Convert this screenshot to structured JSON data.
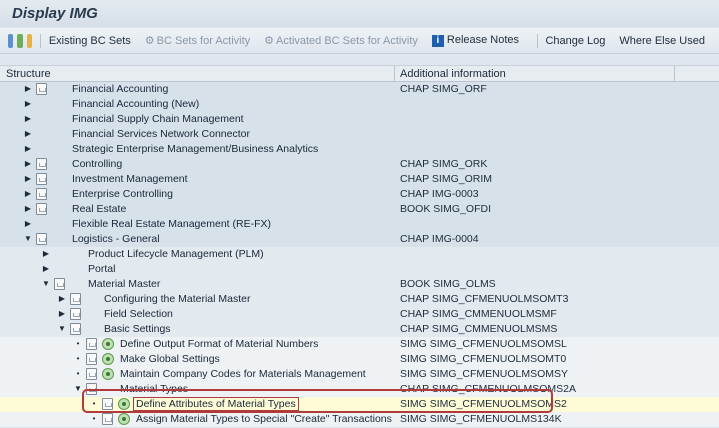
{
  "title": "Display IMG",
  "toolbar": {
    "existing_bc_sets": "Existing BC Sets",
    "bc_sets_for_activity": "BC Sets for Activity",
    "activated_bc_sets": "Activated BC Sets for Activity",
    "release_notes": "Release Notes",
    "change_log": "Change Log",
    "where_else_used": "Where Else Used"
  },
  "columns": {
    "structure": "Structure",
    "additional": "Additional information"
  },
  "rows": [
    {
      "label": "Financial Accounting",
      "info": "CHAP SIMG_ORF",
      "level": 0,
      "arrow": "collapsed",
      "doc": true,
      "exec": false,
      "bg": "bg1"
    },
    {
      "label": "Financial Accounting (New)",
      "info": "",
      "level": 0,
      "arrow": "collapsed",
      "doc": false,
      "exec": false,
      "bg": "bg1"
    },
    {
      "label": "Financial Supply Chain Management",
      "info": "",
      "level": 0,
      "arrow": "collapsed",
      "doc": false,
      "exec": false,
      "bg": "bg1"
    },
    {
      "label": "Financial Services Network Connector",
      "info": "",
      "level": 0,
      "arrow": "collapsed",
      "doc": false,
      "exec": false,
      "bg": "bg1"
    },
    {
      "label": "Strategic Enterprise Management/Business Analytics",
      "info": "",
      "level": 0,
      "arrow": "collapsed",
      "doc": false,
      "exec": false,
      "bg": "bg1"
    },
    {
      "label": "Controlling",
      "info": "CHAP SIMG_ORK",
      "level": 0,
      "arrow": "collapsed",
      "doc": true,
      "exec": false,
      "bg": "bg1"
    },
    {
      "label": "Investment Management",
      "info": "CHAP SIMG_ORIM",
      "level": 0,
      "arrow": "collapsed",
      "doc": true,
      "exec": false,
      "bg": "bg1"
    },
    {
      "label": "Enterprise Controlling",
      "info": "CHAP IMG-0003",
      "level": 0,
      "arrow": "collapsed",
      "doc": true,
      "exec": false,
      "bg": "bg1"
    },
    {
      "label": "Real Estate",
      "info": "BOOK SIMG_OFDI",
      "level": 0,
      "arrow": "collapsed",
      "doc": true,
      "exec": false,
      "bg": "bg1"
    },
    {
      "label": "Flexible Real Estate Management (RE-FX)",
      "info": "",
      "level": 0,
      "arrow": "collapsed",
      "doc": false,
      "exec": false,
      "bg": "bg1"
    },
    {
      "label": "Logistics - General",
      "info": "CHAP IMG-0004",
      "level": 0,
      "arrow": "expanded",
      "doc": true,
      "exec": false,
      "bg": "bg1"
    },
    {
      "label": "Product Lifecycle Management (PLM)",
      "info": "",
      "level": 1,
      "arrow": "collapsed",
      "doc": false,
      "exec": false,
      "bg": "bg2"
    },
    {
      "label": "Portal",
      "info": "",
      "level": 1,
      "arrow": "collapsed",
      "doc": false,
      "exec": false,
      "bg": "bg2"
    },
    {
      "label": "Material Master",
      "info": "BOOK SIMG_OLMS",
      "level": 1,
      "arrow": "expanded",
      "doc": true,
      "exec": false,
      "bg": "bg2"
    },
    {
      "label": "Configuring the Material Master",
      "info": "CHAP SIMG_CFMENUOLMSOMT3",
      "level": 2,
      "arrow": "collapsed",
      "doc": true,
      "exec": false,
      "bg": "bg2"
    },
    {
      "label": "Field Selection",
      "info": "CHAP SIMG_CMMENUOLMSMF",
      "level": 2,
      "arrow": "collapsed",
      "doc": true,
      "exec": false,
      "bg": "bg2"
    },
    {
      "label": "Basic Settings",
      "info": "CHAP SIMG_CMMENUOLMSMS",
      "level": 2,
      "arrow": "expanded",
      "doc": true,
      "exec": false,
      "bg": "bg2"
    },
    {
      "label": "Define Output Format of Material Numbers",
      "info": "SIMG SIMG_CFMENUOLMSOMSL",
      "level": 3,
      "arrow": "dot",
      "doc": true,
      "exec": true,
      "bg": "bg3"
    },
    {
      "label": "Make Global Settings",
      "info": "SIMG SIMG_CFMENUOLMSOMT0",
      "level": 3,
      "arrow": "dot",
      "doc": true,
      "exec": true,
      "bg": "bg3"
    },
    {
      "label": "Maintain Company Codes for Materials Management",
      "info": "SIMG SIMG_CFMENUOLMSOMSY",
      "level": 3,
      "arrow": "dot",
      "doc": true,
      "exec": true,
      "bg": "bg3"
    },
    {
      "label": "Material Types",
      "info": "CHAP SIMG_CFMENUOLMSOMS2A",
      "level": 3,
      "arrow": "expanded",
      "doc": true,
      "exec": false,
      "bg": "bg3"
    },
    {
      "label": "Define Attributes of Material Types",
      "info": "SIMG SIMG_CFMENUOLMSOMS2",
      "level": 4,
      "arrow": "dot",
      "doc": true,
      "exec": true,
      "bg": "hl"
    },
    {
      "label": "Assign Material Types to Special \"Create\" Transactions",
      "info": "SIMG SIMG_CFMENUOLMS134K",
      "level": 4,
      "arrow": "dot",
      "doc": true,
      "exec": true,
      "bg": "bg3"
    }
  ]
}
